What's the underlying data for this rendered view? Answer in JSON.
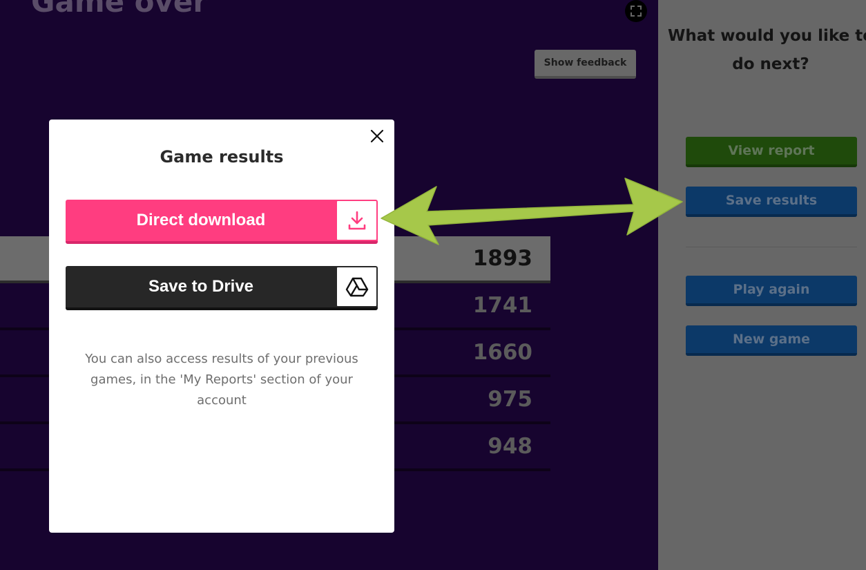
{
  "game": {
    "title": "Game over",
    "show_feedback_label": "Show feedback",
    "scores": [
      "1893",
      "1741",
      "1660",
      "975",
      "948"
    ]
  },
  "panel": {
    "heading": "What would you like to do next?",
    "view_report_label": "View report",
    "save_results_label": "Save results",
    "play_again_label": "Play again",
    "new_game_label": "New game"
  },
  "modal": {
    "title": "Game results",
    "direct_download_label": "Direct download",
    "save_to_drive_label": "Save to Drive",
    "note": "You can also access results of your previous games, in the 'My Reports' section of your account"
  },
  "colors": {
    "background": "#17042f",
    "accent_pink": "#ff3d80",
    "annotation_arrow": "#a6c84a"
  },
  "icons": {
    "close": "close-icon",
    "download": "download-icon",
    "drive": "google-drive-icon",
    "fullscreen": "fullscreen-icon"
  }
}
